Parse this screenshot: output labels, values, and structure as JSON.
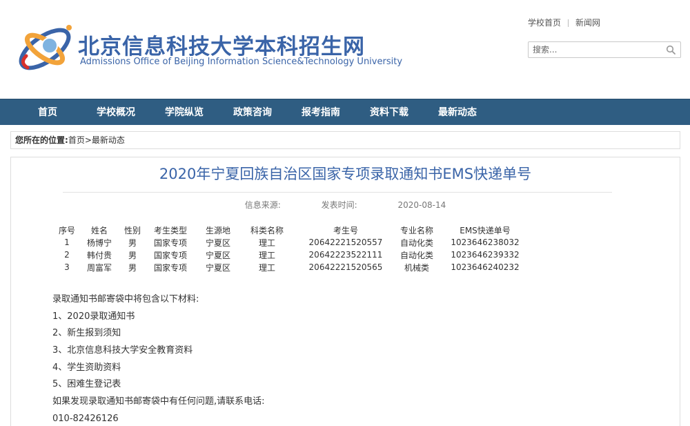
{
  "header": {
    "title_cn": "北京信息科技大学本科招生网",
    "title_en": "Admissions Office of Beijing Information Science&Technology University",
    "links": [
      "学校首页",
      "新闻网"
    ],
    "search_placeholder": "搜索..."
  },
  "nav": {
    "items": [
      "首页",
      "学校概况",
      "学院纵览",
      "政策咨询",
      "报考指南",
      "资料下载",
      "最新动态"
    ]
  },
  "breadcrumb": {
    "label": "您所在的位置:",
    "home": "首页",
    "separator": ">",
    "current": "最新动态"
  },
  "article": {
    "title": "2020年宁夏回族自治区国家专项录取通知书EMS快递单号",
    "source_label": "信息来源:",
    "date_label": "发表时间:",
    "date": "2020-08-14",
    "table": {
      "headers": [
        "序号",
        "姓名",
        "性别",
        "考生类型",
        "生源地",
        "科类名称",
        "考生号",
        "专业名称",
        "EMS快递单号"
      ],
      "rows": [
        [
          "1",
          "杨博宁",
          "男",
          "国家专项",
          "宁夏区",
          "理工",
          "20642221520557",
          "自动化类",
          "1023646238032"
        ],
        [
          "2",
          "韩付贵",
          "男",
          "国家专项",
          "宁夏区",
          "理工",
          "20642223522111",
          "自动化类",
          "1023646239332"
        ],
        [
          "3",
          "周富军",
          "男",
          "国家专项",
          "宁夏区",
          "理工",
          "20642221520565",
          "机械类",
          "1023646240232"
        ]
      ]
    },
    "paragraphs": [
      "录取通知书邮寄袋中将包含以下材料:",
      "1、2020录取通知书",
      "2、新生报到须知",
      "3、北京信息科技大学安全教育资料",
      "4、学生资助资料",
      "5、困难生登记表",
      "如果发现录取通知书邮寄袋中有任何问题,请联系电话:",
      "010-82426126"
    ]
  },
  "colors": {
    "brand_blue": "#3a64a8",
    "nav_bg": "#2f5d82",
    "logo_orange": "#f2a33a"
  },
  "icons": {
    "logo": "university-orbit-logo",
    "search": "search-icon"
  }
}
